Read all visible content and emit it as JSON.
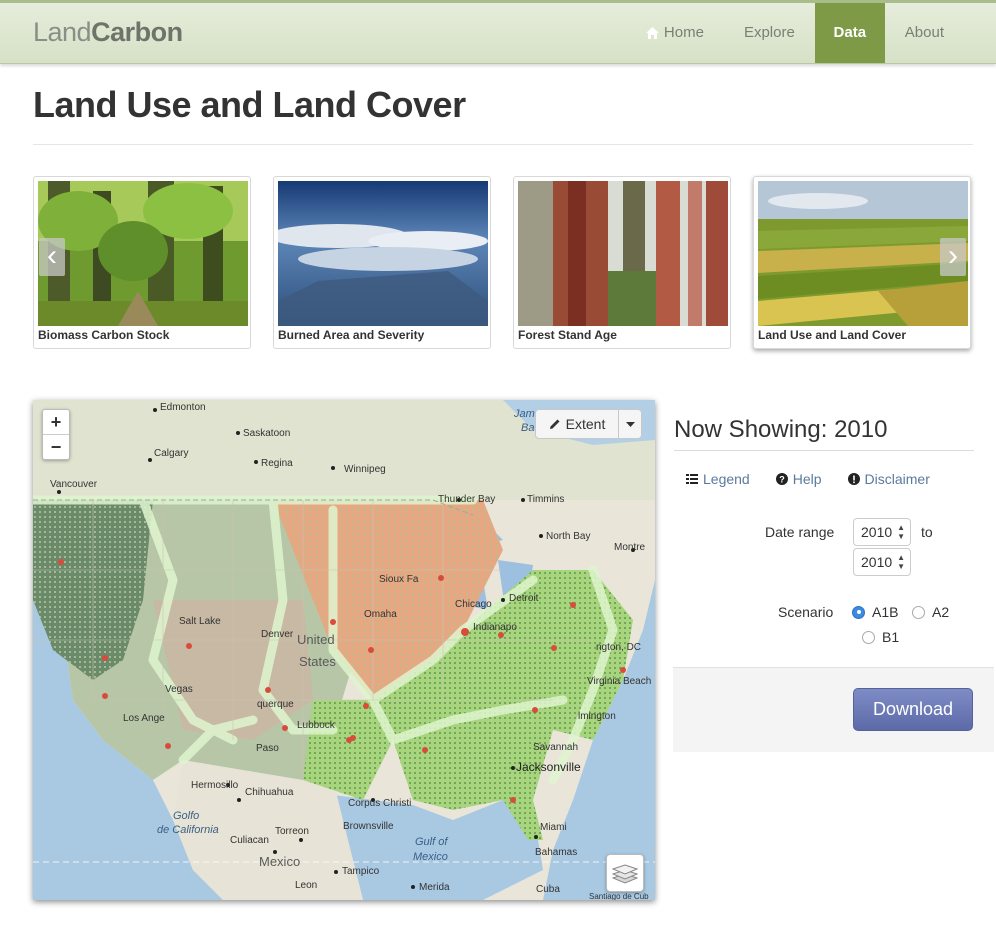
{
  "navbar": {
    "brand_light": "Land",
    "brand_bold": "Carbon",
    "items": [
      {
        "label": "Home",
        "icon": "home-icon"
      },
      {
        "label": "Explore"
      },
      {
        "label": "Data",
        "active": true
      },
      {
        "label": "About"
      }
    ],
    "accent_color": "#7f9a47"
  },
  "page": {
    "title": "Land Use and Land Cover"
  },
  "carousel": {
    "items": [
      {
        "caption": "Biomass Carbon Stock"
      },
      {
        "caption": "Burned Area and Severity"
      },
      {
        "caption": "Forest Stand Age"
      },
      {
        "caption": "Land Use and Land Cover",
        "active": true
      }
    ],
    "prev_icon": "chevron-left-icon",
    "next_icon": "chevron-right-icon"
  },
  "map": {
    "zoom_in": "+",
    "zoom_out": "−",
    "extent_label": "Extent",
    "labels": {
      "edmonton": "Edmonton",
      "saskatoon": "Saskatoon",
      "calgary": "Calgary",
      "regina": "Regina",
      "winnipeg": "Winnipeg",
      "vancouver": "Vancouver",
      "thunder_bay": "Thunder Bay",
      "timmins": "Timmins",
      "north_bay": "North Bay",
      "montreal": "Montre",
      "sioux_falls": "Sioux Fa",
      "omaha": "Omaha",
      "chicago": "Chicago",
      "detroit": "Detroit",
      "indianapolis": "Indianapo",
      "salt_lake": "Salt Lake",
      "denver": "Denver",
      "united": "United",
      "states": "States",
      "washington": "ngton, DC",
      "las_vegas": "Vegas",
      "los_angeles": "Los Ange",
      "albuquerque": "querque",
      "lubbock": "Lubbock",
      "el_paso": "Paso",
      "virginia_beach": "Virginia Beach",
      "wilmington": "lmington",
      "savannah": "Savannah",
      "jacksonville": "Jacksonville",
      "hermosillo": "Hermosillo",
      "chihuahua": "Chihuahua",
      "corpus": "Corpus Christi",
      "brownsville": "Brownsville",
      "golfo": "Golfo",
      "de_california": "de California",
      "culiacan": "Culiacan",
      "torreon": "Torreon",
      "miami": "Miami",
      "gulf_of": "Gulf of",
      "mexico_water": "Mexico",
      "bahamas": "Bahamas",
      "mexico": "Mexico",
      "tampico": "Tampico",
      "leon": "Leon",
      "merida": "Merida",
      "cuba": "Cuba",
      "santiago": "Santiago de Cub",
      "james_bay_1": "Jam",
      "james_bay_2": "Ba"
    }
  },
  "panel": {
    "now_showing": "Now Showing: 2010",
    "links": [
      {
        "label": "Legend",
        "icon": "list-icon"
      },
      {
        "label": "Help",
        "icon": "question-circle-icon"
      },
      {
        "label": "Disclaimer",
        "icon": "exclamation-circle-icon"
      }
    ],
    "date_range_label": "Date range",
    "date_from": "2010",
    "date_to": "2010",
    "to_label": "to",
    "scenario_label": "Scenario",
    "scenarios": [
      {
        "label": "A1B",
        "checked": true
      },
      {
        "label": "A2",
        "checked": false
      },
      {
        "label": "B1",
        "checked": false
      }
    ],
    "download_label": "Download"
  }
}
